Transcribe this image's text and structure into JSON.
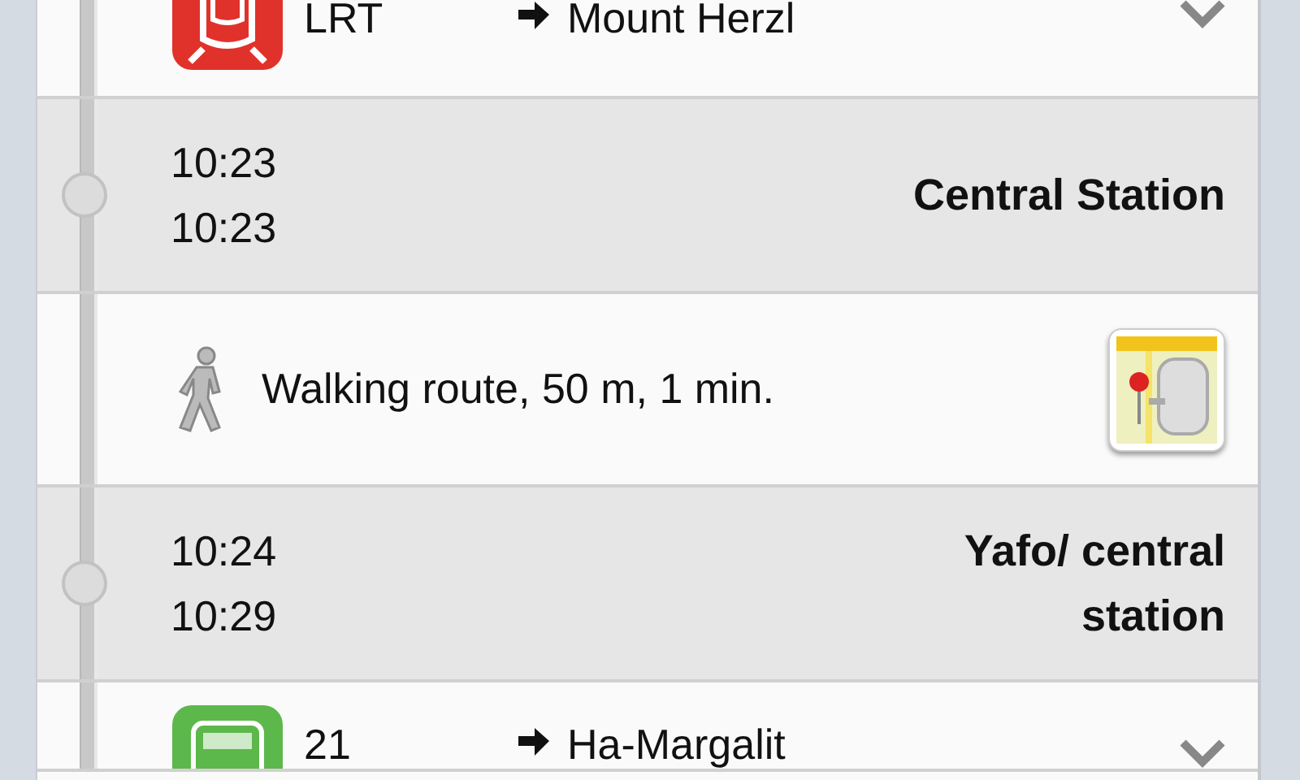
{
  "segments": [
    {
      "kind": "ride",
      "line": "LRT",
      "direction": "Mount Herzl",
      "color": "#e0322b"
    },
    {
      "kind": "stop",
      "arrive": "10:23",
      "depart": "10:23",
      "name": "Central Station"
    },
    {
      "kind": "walk",
      "text": "Walking route, 50 m, 1 min."
    },
    {
      "kind": "stop",
      "arrive": "10:24",
      "depart": "10:29",
      "name": "Yafo/ central station"
    },
    {
      "kind": "ride",
      "line": "21",
      "direction": "Ha-Margalit",
      "color": "#5cb84a"
    }
  ]
}
